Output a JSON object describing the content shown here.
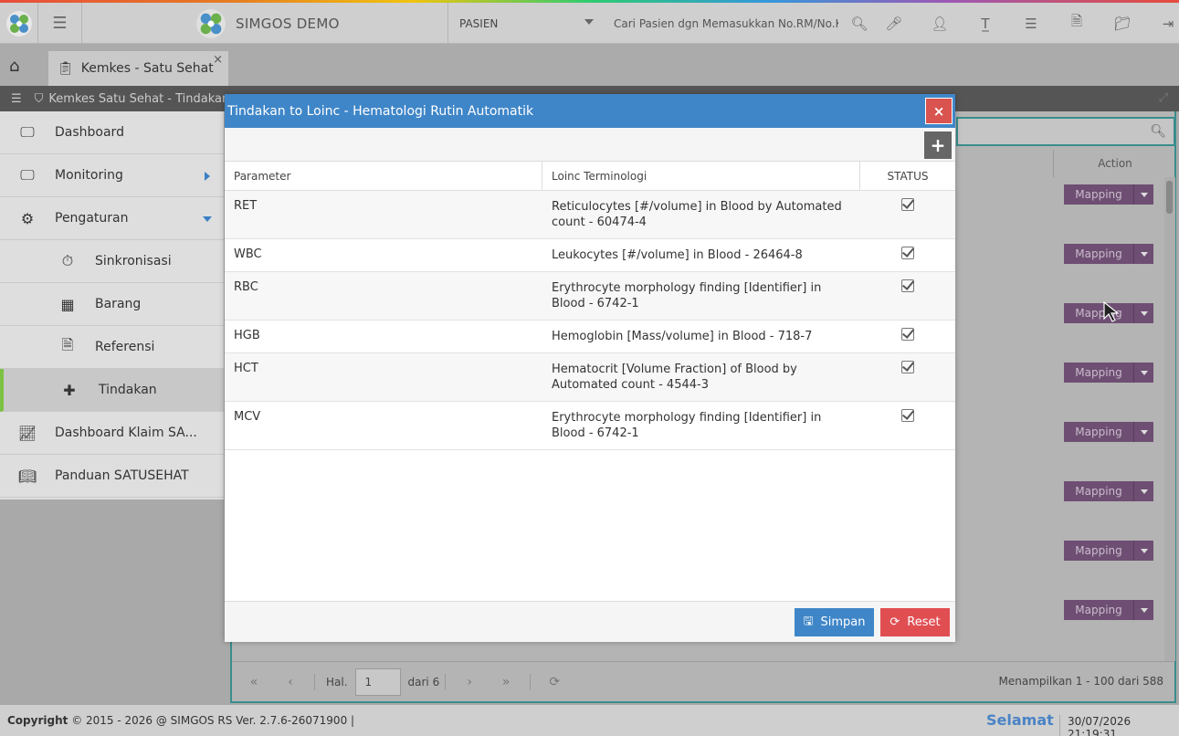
{
  "app": {
    "title": "SIMGOS DEMO"
  },
  "topbar": {
    "search_category": "PASIEN",
    "search_placeholder": "Cari Pasien dgn Memasukkan No.RM/No.K"
  },
  "tabs": [
    {
      "label": "Kemkes - Satu Sehat",
      "close": "×"
    }
  ],
  "breadcrumb": {
    "text": "Kemkes Satu Sehat - Tindakan"
  },
  "sidebar": {
    "items": [
      {
        "label": "Dashboard",
        "icon": "monitor-icon"
      },
      {
        "label": "Monitoring",
        "icon": "monitor-icon"
      },
      {
        "label": "Pengaturan",
        "icon": "gears-icon"
      },
      {
        "label": "Sinkronisasi",
        "icon": "stopwatch-icon"
      },
      {
        "label": "Barang",
        "icon": "boxes-icon"
      },
      {
        "label": "Referensi",
        "icon": "file-code-icon"
      },
      {
        "label": "Tindakan",
        "icon": "medkit-icon"
      },
      {
        "label": "Dashboard Klaim SA...",
        "icon": "chart-line-icon"
      },
      {
        "label": "Panduan SATUSEHAT",
        "icon": "book-icon"
      }
    ]
  },
  "content": {
    "action_header": "Action",
    "mapping_label": "Mapping",
    "mapping_count": 8
  },
  "pager": {
    "hal_label": "Hal.",
    "page": "1",
    "of_label": "dari 6",
    "showing": "Menampilkan 1 - 100 dari 588"
  },
  "footer": {
    "copyright_label": "Copyright",
    "copyright_text": "2015 - 2026 @ SIMGOS RS Ver. 2.7.6-26071900",
    "greeting": "Selamat",
    "datetime": "30/07/2026 21:19:31"
  },
  "modal": {
    "title": "Tindakan to Loinc - Hematologi Rutin Automatik",
    "close": "×",
    "add": "+",
    "columns": {
      "parameter": "Parameter",
      "loinc": "Loinc Terminologi",
      "status": "STATUS"
    },
    "rows": [
      {
        "parameter": "RET",
        "loinc": "Reticulocytes [#/volume] in Blood by Automated count - 60474-4",
        "checked": true
      },
      {
        "parameter": "WBC",
        "loinc": "Leukocytes [#/volume] in Blood - 26464-8",
        "checked": true
      },
      {
        "parameter": "RBC",
        "loinc": "Erythrocyte morphology finding [Identifier] in Blood - 6742-1",
        "checked": true
      },
      {
        "parameter": "HGB",
        "loinc": "Hemoglobin [Mass/volume] in Blood - 718-7",
        "checked": true
      },
      {
        "parameter": "HCT",
        "loinc": "Hematocrit [Volume Fraction] of Blood by Automated count - 4544-3",
        "checked": true
      },
      {
        "parameter": "MCV",
        "loinc": "Erythrocyte morphology finding [Identifier] in Blood - 6742-1",
        "checked": true
      }
    ],
    "save_label": "Simpan",
    "reset_label": "Reset"
  },
  "colors": {
    "modal_header": "#3f86c8",
    "close_red": "#d9534f",
    "mapping_purple": "#6e4f73",
    "active_green": "#7cc243"
  }
}
